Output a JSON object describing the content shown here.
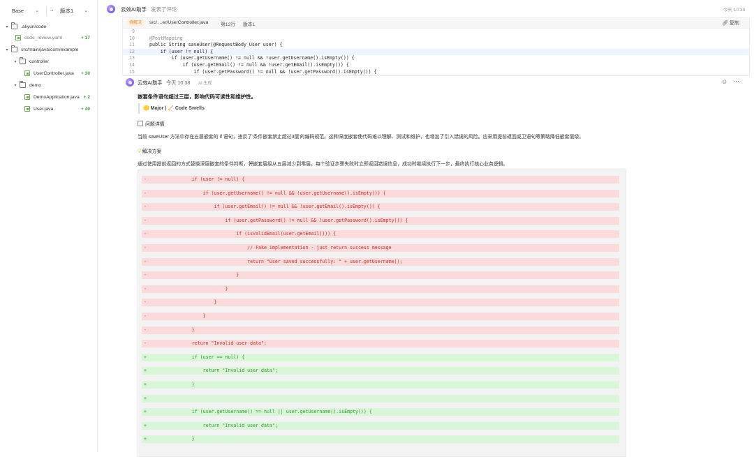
{
  "sidebar": {
    "base_label": "Base",
    "version_label": "版本1",
    "tree": [
      {
        "type": "folder",
        "label": ".aliyun/code"
      },
      {
        "type": "file",
        "label": "code_review.yaml",
        "count": "+ 17"
      },
      {
        "type": "folder",
        "label": "src/main/java/com/example"
      },
      {
        "type": "folder",
        "label": "controller"
      },
      {
        "type": "file",
        "label": "UserController.java",
        "count": "+ 30"
      },
      {
        "type": "folder",
        "label": "demo"
      },
      {
        "type": "file",
        "label": "DemoApplication.java",
        "count": "+ 2"
      },
      {
        "type": "file",
        "label": "User.java",
        "count": "+ 40"
      }
    ]
  },
  "activity": {
    "author": "云效AI助手",
    "action": "发表了评论",
    "time": "今天 10:38"
  },
  "file_card": {
    "status": "待解决",
    "path": "src/ ...er/UserController.java",
    "line": "第12行",
    "version": "版本1",
    "copy_label": "复制",
    "lines": [
      {
        "n": "9",
        "code": ""
      },
      {
        "n": "10",
        "code": "@PostMapping"
      },
      {
        "n": "11",
        "code": "public String saveUser(@RequestBody User user) {"
      },
      {
        "n": "12",
        "code": "    if (user != null) {"
      },
      {
        "n": "13",
        "code": "        if (user.getUsername() != null && !user.getUsername().isEmpty()) {"
      },
      {
        "n": "14",
        "code": "            if (user.getEmail() != null && !user.getEmail().isEmpty()) {"
      },
      {
        "n": "15",
        "code": "                if (user.getPassword() != null && !user.getPassword().isEmpty()) {"
      }
    ]
  },
  "comment": {
    "author": "云效AI助手",
    "time": "今天 10:38",
    "generated": "AI 生成",
    "title": "嵌套条件语句超过三层，影响代码可读性和维护性。",
    "severity": "🟡 Major | 🧹 Code Smells",
    "detail_heading": "问题详情",
    "detail_text": "当前 saveUser 方法中存在五层嵌套的 if 语句，违反了'条件嵌套禁止超过3层'的编码规范。这种深度嵌套使代码难以理解、测试和维护，也增加了引入错误的风险。应采用提前返回或卫语句等策略降低嵌套层级。",
    "solution_heading": "解决方案",
    "solution_text": "通过使用提前返回的方式替换深层嵌套的条件判断，将嵌套层级从五层减少到零层。每个验证步骤失败时立即返回错误信息，成功时继续执行下一步，最终执行核心业务逻辑。"
  },
  "diff": [
    {
      "t": "del",
      "s": "-",
      "code": "        if (user != null) {"
    },
    {
      "t": "del",
      "s": "-",
      "code": "            if (user.getUsername() != null && !user.getUsername().isEmpty()) {"
    },
    {
      "t": "del",
      "s": "-",
      "code": "                if (user.getEmail() != null && !user.getEmail().isEmpty()) {"
    },
    {
      "t": "del",
      "s": "-",
      "code": "                    if (user.getPassword() != null && !user.getPassword().isEmpty()) {"
    },
    {
      "t": "del",
      "s": "-",
      "code": "                        if (isValidEmail(user.getEmail())) {"
    },
    {
      "t": "del",
      "s": "-",
      "code": "                            // Fake implementation - just return success message"
    },
    {
      "t": "del",
      "s": "-",
      "code": "                            return \"User saved successfully: \" + user.getUsername();"
    },
    {
      "t": "del",
      "s": "-",
      "code": "                        }"
    },
    {
      "t": "del",
      "s": "-",
      "code": "                    }"
    },
    {
      "t": "del",
      "s": "-",
      "code": "                }"
    },
    {
      "t": "del",
      "s": "-",
      "code": "            }"
    },
    {
      "t": "del",
      "s": "-",
      "code": "        }"
    },
    {
      "t": "del",
      "s": "-",
      "code": "        return \"Invalid user data\";"
    },
    {
      "t": "add",
      "s": "+",
      "code": "        if (user == null) {"
    },
    {
      "t": "add",
      "s": "+",
      "code": "            return \"Invalid user data\";"
    },
    {
      "t": "add",
      "s": "+",
      "code": "        }"
    },
    {
      "t": "add",
      "s": "+",
      "code": ""
    },
    {
      "t": "add",
      "s": "+",
      "code": "        if (user.getUsername() == null || user.getUsername().isEmpty()) {"
    },
    {
      "t": "add",
      "s": "+",
      "code": "            return \"Invalid user data\";"
    },
    {
      "t": "add",
      "s": "+",
      "code": "        }"
    }
  ]
}
